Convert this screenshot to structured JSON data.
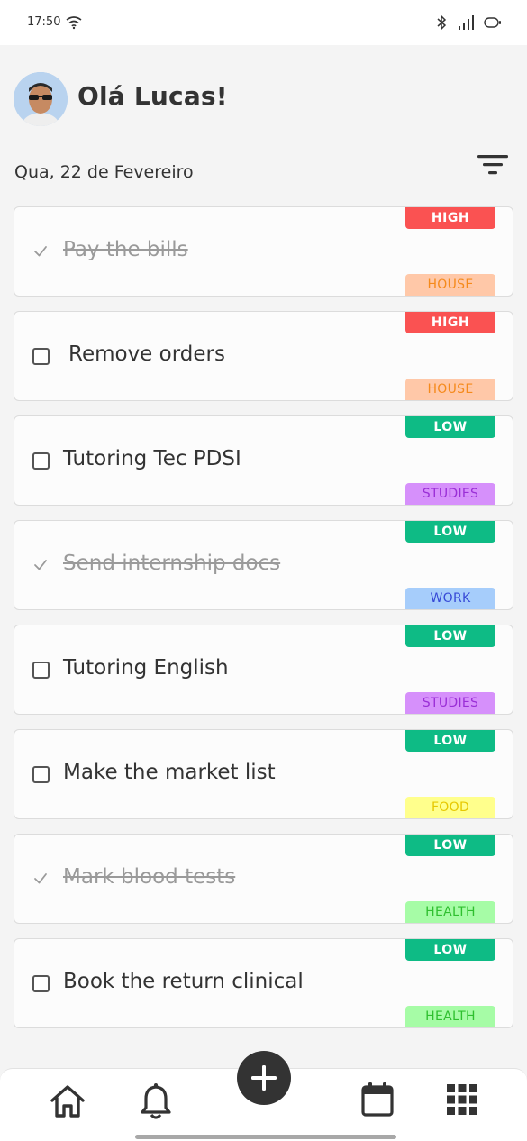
{
  "status_bar": {
    "time": "17:50"
  },
  "header": {
    "greeting": "Olá Lucas!",
    "date": "Qua, 22 de Fevereiro"
  },
  "tasks": [
    {
      "title": "Pay the bills",
      "done": true,
      "priority": "HIGH",
      "category": "HOUSE"
    },
    {
      "title": "Remove orders",
      "done": false,
      "priority": "HIGH",
      "category": "HOUSE"
    },
    {
      "title": "Tutoring Tec PDSI",
      "done": false,
      "priority": "LOW",
      "category": "STUDIES"
    },
    {
      "title": "Send internship docs",
      "done": true,
      "priority": "LOW",
      "category": "WORK"
    },
    {
      "title": "Tutoring English",
      "done": false,
      "priority": "LOW",
      "category": "STUDIES"
    },
    {
      "title": "Make the market list",
      "done": false,
      "priority": "LOW",
      "category": "FOOD"
    },
    {
      "title": "Mark blood tests",
      "done": true,
      "priority": "LOW",
      "category": "HEALTH"
    },
    {
      "title": "Book the return clinical",
      "done": false,
      "priority": "LOW",
      "category": "HEALTH"
    }
  ],
  "colors": {
    "priority": {
      "HIGH": "#fa5252",
      "LOW": "#0ebb85"
    },
    "category_bg": {
      "HOUSE": "#ffc8a8",
      "STUDIES": "#d690fb",
      "WORK": "#a6cdfb",
      "FOOD": "#ffff8c",
      "HEALTH": "#a6fca6"
    },
    "category_text": {
      "HOUSE": "#f58a1c",
      "STUDIES": "#9a2ed6",
      "WORK": "#3648d6",
      "FOOD": "#e6c800",
      "HEALTH": "#2fbf2f"
    }
  },
  "nav": {
    "icons": [
      "home-icon",
      "bell-icon",
      "plus-icon",
      "calendar-icon",
      "grid-icon"
    ]
  }
}
